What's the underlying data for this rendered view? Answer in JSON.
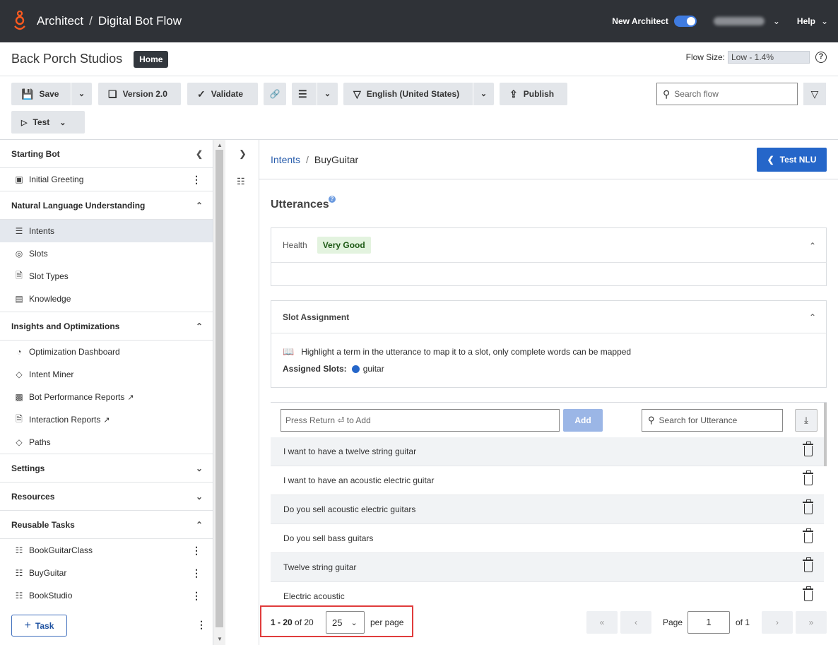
{
  "topbar": {
    "app": "Architect",
    "flow_type": "Digital Bot Flow",
    "new_architect_label": "New Architect",
    "new_architect_on": true,
    "help": "Help"
  },
  "org": {
    "name": "Back Porch Studios",
    "home": "Home",
    "flow_size_label": "Flow Size:",
    "flow_size_value": "Low - 1.4%"
  },
  "toolbar": {
    "save": "Save",
    "version": "Version 2.0",
    "validate": "Validate",
    "language": "English (United States)",
    "publish": "Publish",
    "test": "Test",
    "search_placeholder": "Search flow"
  },
  "sidebar": {
    "starting_bot": "Starting Bot",
    "initial_greeting": "Initial Greeting",
    "nlu": "Natural Language Understanding",
    "nlu_items": [
      "Intents",
      "Slots",
      "Slot Types",
      "Knowledge"
    ],
    "insights": "Insights and Optimizations",
    "insights_items": [
      "Optimization Dashboard",
      "Intent Miner",
      "Bot Performance Reports",
      "Interaction Reports",
      "Paths"
    ],
    "settings": "Settings",
    "resources": "Resources",
    "reusable_tasks": "Reusable Tasks",
    "tasks": [
      "BookGuitarClass",
      "BuyGuitar",
      "BookStudio"
    ],
    "add_task": "Task"
  },
  "main": {
    "breadcrumb_link": "Intents",
    "breadcrumb_current": "BuyGuitar",
    "test_nlu": "Test NLU",
    "utterances_title": "Utterances",
    "health_label": "Health",
    "health_value": "Very Good",
    "slot_assignment": "Slot Assignment",
    "slot_hint": "Highlight a term in the utterance to map it to a slot, only complete words can be mapped",
    "assigned_slots_label": "Assigned Slots:",
    "assigned_slot": "guitar",
    "utt_input_placeholder": "Press Return ⏎ to Add",
    "add": "Add",
    "utt_search_placeholder": "Search for Utterance",
    "utterances": [
      "I want to have a twelve string guitar",
      "I want to have an acoustic electric guitar",
      "Do you sell acoustic electric guitars",
      "Do you sell bass guitars",
      "Twelve string guitar",
      "Electric acoustic"
    ]
  },
  "pager": {
    "range": "1 - 20",
    "of_total": "of 20",
    "per_page_value": "25",
    "per_page_label": "per page",
    "page_label": "Page",
    "page_value": "1",
    "of_pages": "of 1"
  },
  "colors": {
    "topbar_bg": "#2f3237",
    "primary_blue": "#2566c9",
    "health_badge_bg": "#e3f3df",
    "highlight_red": "#e03c3c"
  }
}
